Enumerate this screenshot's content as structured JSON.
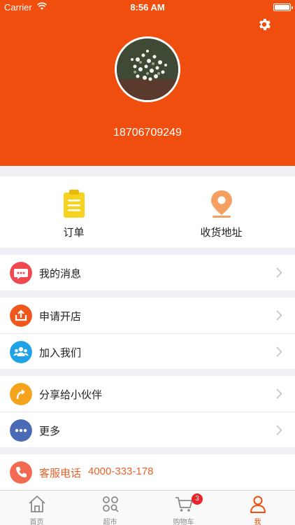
{
  "status_bar": {
    "carrier": "Carrier",
    "time": "8:56 AM"
  },
  "profile": {
    "phone": "18706709249"
  },
  "quick_actions": [
    {
      "label": "订单",
      "icon": "clipboard-icon"
    },
    {
      "label": "收货地址",
      "icon": "location-pin-icon"
    }
  ],
  "menu": {
    "messages": "我的消息",
    "open_store": "申请开店",
    "join_us": "加入我们",
    "share": "分享给小伙伴",
    "more": "更多",
    "hotline_label": "客服电话",
    "hotline_number": "4000-333-178"
  },
  "tabs": [
    {
      "label": "首页",
      "icon": "home-icon"
    },
    {
      "label": "超市",
      "icon": "grid-search-icon"
    },
    {
      "label": "购物车",
      "icon": "cart-icon",
      "badge": "3"
    },
    {
      "label": "我",
      "icon": "person-icon",
      "active": true
    }
  ],
  "colors": {
    "brand": "#f04e0e",
    "messages_icon": "#f0484f",
    "open_store_icon": "#f0571c",
    "join_us_icon": "#1fa3e6",
    "share_icon": "#f5a21c",
    "more_icon": "#4a6ab6",
    "hotline_icon": "#f36a52",
    "badge": "#e8232c"
  }
}
